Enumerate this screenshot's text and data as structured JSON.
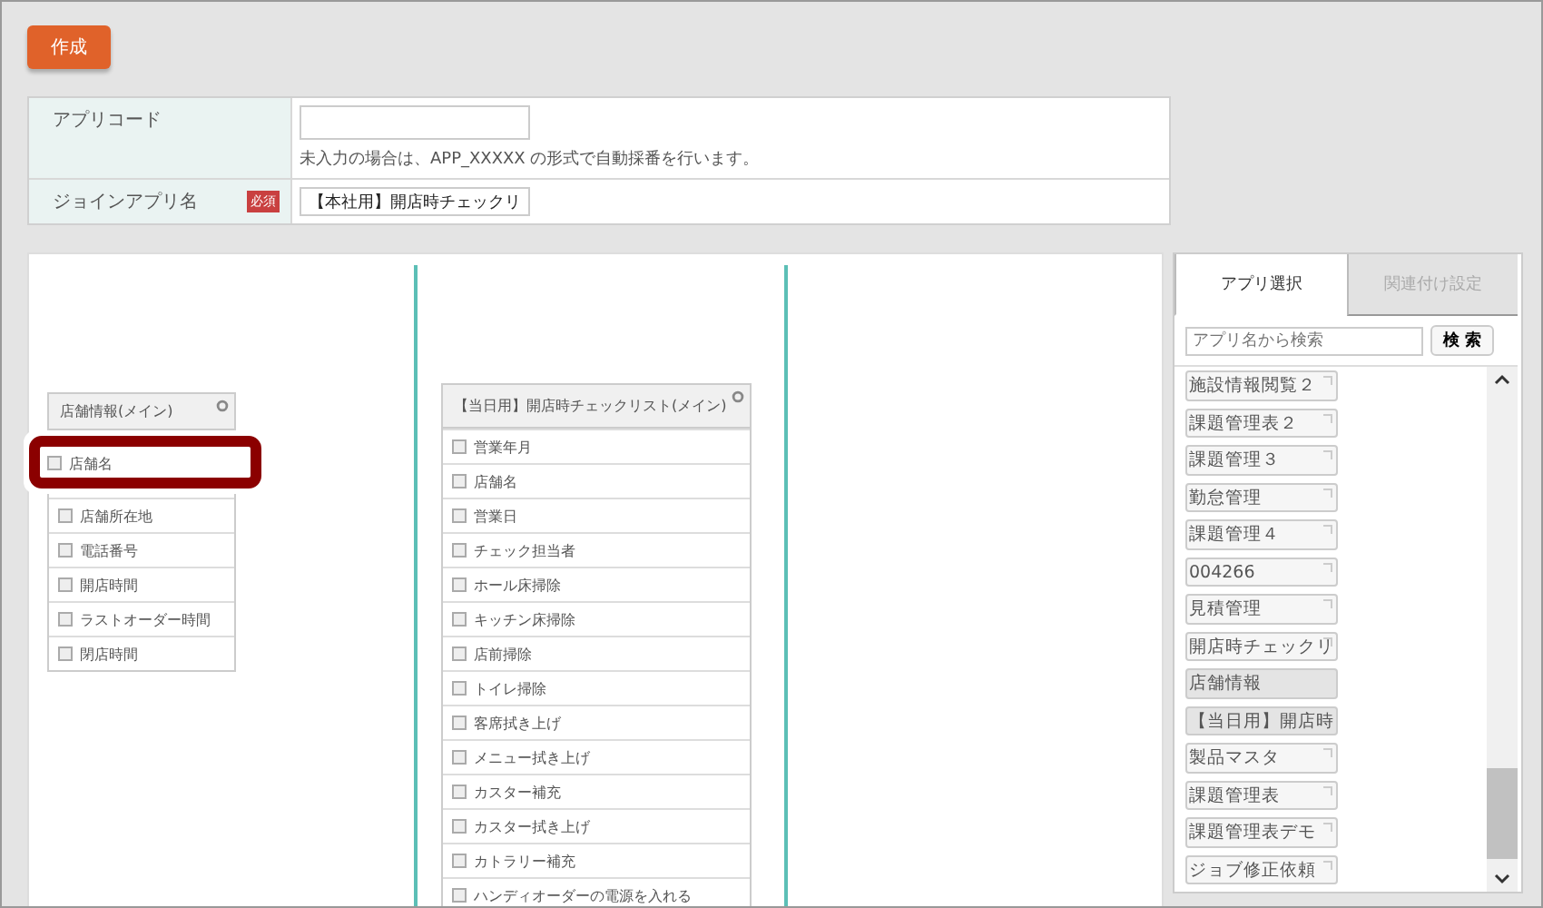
{
  "create_button": "作成",
  "form": {
    "rows": [
      {
        "kind": "code",
        "label": "アプリコード",
        "note": "未入力の場合は、APP_XXXXX の形式で自動採番を行います。"
      },
      {
        "kind": "join",
        "label": "ジョインアプリ名",
        "badge": "必須",
        "value": "【本社用】開店時チェックリ"
      }
    ]
  },
  "tables": [
    {
      "title": "店舗情報(メイン)",
      "fields": [
        {
          "label": "店舗名",
          "highlighted": true
        },
        {
          "label": "店舗所在地",
          "highlighted": false
        },
        {
          "label": "電話番号",
          "highlighted": false
        },
        {
          "label": "開店時間",
          "highlighted": false
        },
        {
          "label": "ラストオーダー時間",
          "highlighted": false
        },
        {
          "label": "閉店時間",
          "highlighted": false
        }
      ]
    },
    {
      "title": "【当日用】開店時チェックリスト(メイン)",
      "fields": [
        {
          "label": "営業年月",
          "highlighted": false
        },
        {
          "label": "店舗名",
          "highlighted": false
        },
        {
          "label": "営業日",
          "highlighted": false
        },
        {
          "label": "チェック担当者",
          "highlighted": false
        },
        {
          "label": "ホール床掃除",
          "highlighted": false
        },
        {
          "label": "キッチン床掃除",
          "highlighted": false
        },
        {
          "label": "店前掃除",
          "highlighted": false
        },
        {
          "label": "トイレ掃除",
          "highlighted": false
        },
        {
          "label": "客席拭き上げ",
          "highlighted": false
        },
        {
          "label": "メニュー拭き上げ",
          "highlighted": false
        },
        {
          "label": "カスター補充",
          "highlighted": false
        },
        {
          "label": "カスター拭き上げ",
          "highlighted": false
        },
        {
          "label": "カトラリー補充",
          "highlighted": false
        },
        {
          "label": "ハンディオーダーの電源を入れる",
          "highlighted": false
        }
      ]
    }
  ],
  "side_panel": {
    "tabs": [
      {
        "label": "アプリ選択",
        "selected": true
      },
      {
        "label": "関連付け設定",
        "selected": false
      }
    ],
    "search": {
      "placeholder": "アプリ名から検索",
      "button": "検 索"
    },
    "apps": [
      {
        "name": "施設情報閲覧２",
        "used": false
      },
      {
        "name": "課題管理表２",
        "used": false
      },
      {
        "name": "課題管理３",
        "used": false
      },
      {
        "name": "勤怠管理",
        "used": false
      },
      {
        "name": "課題管理４",
        "used": false
      },
      {
        "name": "004266",
        "used": false
      },
      {
        "name": "見積管理",
        "used": false
      },
      {
        "name": "開店時チェックリ",
        "used": false
      },
      {
        "name": "店舗情報",
        "used": true
      },
      {
        "name": "【当日用】開店時",
        "used": true
      },
      {
        "name": "製品マスタ",
        "used": false
      },
      {
        "name": "課題管理表",
        "used": false
      },
      {
        "name": "課題管理表デモ",
        "used": false
      },
      {
        "name": "ジョブ修正依頼",
        "used": false
      }
    ]
  }
}
